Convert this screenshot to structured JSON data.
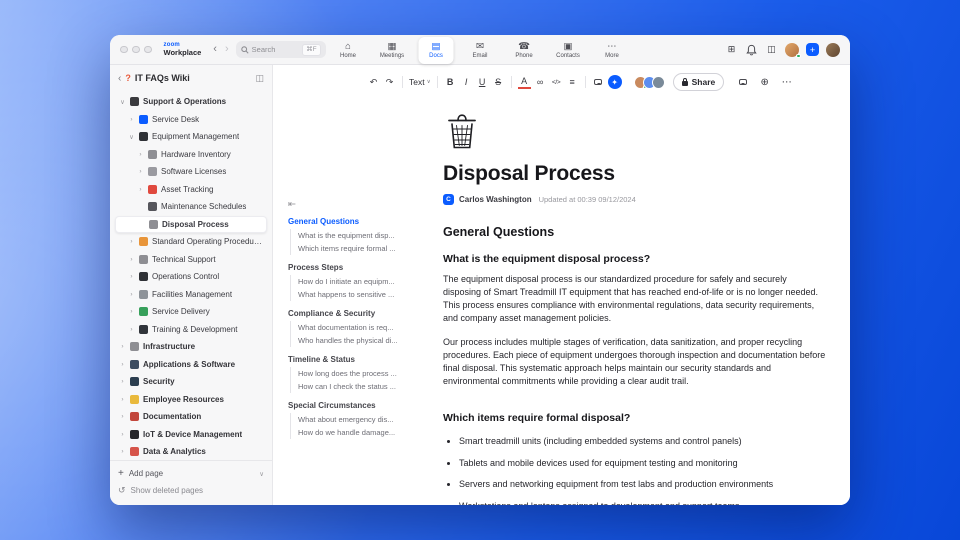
{
  "accent_color": "#0b5cff",
  "titlebar": {
    "logo_primary": "zoom",
    "logo_secondary": "Workplace",
    "back_glyph": "‹",
    "forward_glyph": "›",
    "search": {
      "placeholder": "Search",
      "shortcut": "⌘F"
    },
    "tabs": [
      {
        "name": "tab-home",
        "label": "Home",
        "glyph": "⌂"
      },
      {
        "name": "tab-meetings",
        "label": "Meetings",
        "glyph": "▦"
      },
      {
        "name": "tab-docs",
        "label": "Docs",
        "glyph": "▤",
        "active": true
      },
      {
        "name": "tab-email",
        "label": "Email",
        "glyph": "✉"
      },
      {
        "name": "tab-phone",
        "label": "Phone",
        "glyph": "☎"
      },
      {
        "name": "tab-contacts",
        "label": "Contacts",
        "glyph": "▣"
      },
      {
        "name": "tab-more",
        "label": "More",
        "glyph": "⋯"
      }
    ],
    "right_icons": [
      {
        "name": "apps-grid-icon",
        "glyph": "⊞"
      },
      {
        "name": "notifications-bell-icon",
        "glyph": "bell"
      },
      {
        "name": "side-panel-icon",
        "glyph": "◫"
      }
    ],
    "plus_glyph": "+",
    "plus_color": "#0b5cff"
  },
  "sidebar": {
    "header": {
      "title": "IT FAQs Wiki",
      "icon_glyph": "?",
      "icon_color": "#e8593a",
      "back_glyph": "‹",
      "collapse_glyph": "◫"
    },
    "items": [
      {
        "label": "Support & Operations",
        "depth": 0,
        "icon": "phone-icon",
        "color": "#3a3a3e",
        "chevron": "down"
      },
      {
        "label": "Service Desk",
        "depth": 1,
        "icon": "service-desk-icon",
        "color": "#0b5cff",
        "chevron": "right"
      },
      {
        "label": "Equipment Management",
        "depth": 1,
        "icon": "equipment-icon",
        "color": "#2f3136",
        "chevron": "down"
      },
      {
        "label": "Hardware Inventory",
        "depth": 2,
        "icon": "hardware-icon",
        "color": "#8e8e93",
        "chevron": "right"
      },
      {
        "label": "Software Licenses",
        "depth": 2,
        "icon": "software-icon",
        "color": "#9a9aa0",
        "chevron": "right"
      },
      {
        "label": "Asset Tracking",
        "depth": 2,
        "icon": "asset-pin-icon",
        "color": "#e0493e",
        "chevron": "right"
      },
      {
        "label": "Maintenance Schedules",
        "depth": 2,
        "icon": "maintenance-icon",
        "color": "#55555b",
        "chevron": "none"
      },
      {
        "label": "Disposal Process",
        "depth": 2,
        "icon": "disposal-trash-icon",
        "color": "#8e8e93",
        "chevron": "none",
        "selected": true
      },
      {
        "label": "Standard Operating Procedures",
        "depth": 1,
        "icon": "sop-book-icon",
        "color": "#e8953a",
        "chevron": "right"
      },
      {
        "label": "Technical Support",
        "depth": 1,
        "icon": "technical-support-icon",
        "color": "#8e8e93",
        "chevron": "right"
      },
      {
        "label": "Operations Control",
        "depth": 1,
        "icon": "operations-icon",
        "color": "#2f3136",
        "chevron": "right"
      },
      {
        "label": "Facilities Management",
        "depth": 1,
        "icon": "facilities-icon",
        "color": "#8e9399",
        "chevron": "right"
      },
      {
        "label": "Service Delivery",
        "depth": 1,
        "icon": "delivery-icon",
        "color": "#37a05b",
        "chevron": "right"
      },
      {
        "label": "Training & Development",
        "depth": 1,
        "icon": "training-icon",
        "color": "#30343a",
        "chevron": "right"
      },
      {
        "label": "Infrastructure",
        "depth": 0,
        "icon": "infrastructure-icon",
        "color": "#8e8e93",
        "chevron": "right"
      },
      {
        "label": "Applications & Software",
        "depth": 0,
        "icon": "applications-icon",
        "color": "#3c4c60",
        "chevron": "right"
      },
      {
        "label": "Security",
        "depth": 0,
        "icon": "security-icon",
        "color": "#2c3e50",
        "chevron": "right"
      },
      {
        "label": "Employee Resources",
        "depth": 0,
        "icon": "employee-icon",
        "color": "#e9b93c",
        "chevron": "right"
      },
      {
        "label": "Documentation",
        "depth": 0,
        "icon": "documentation-icon",
        "color": "#c2463c",
        "chevron": "right"
      },
      {
        "label": "IoT & Device Management",
        "depth": 0,
        "icon": "iot-icon",
        "color": "#26262a",
        "chevron": "right"
      },
      {
        "label": "Data & Analytics",
        "depth": 0,
        "icon": "analytics-icon",
        "color": "#d6544a",
        "chevron": "right"
      }
    ],
    "footer": {
      "add_page": "Add page",
      "add_glyph": "+",
      "collapse_glyph": "∨",
      "show_deleted": "Show deleted pages",
      "deleted_glyph": "↺"
    }
  },
  "outline": {
    "collapse_glyph": "⇤",
    "sections": [
      {
        "title": "General Questions",
        "active": true,
        "items": [
          "What is the equipment disp...",
          "Which items require formal ..."
        ]
      },
      {
        "title": "Process Steps",
        "items": [
          "How do I initiate an equipm...",
          "What happens to sensitive ..."
        ]
      },
      {
        "title": "Compliance & Security",
        "items": [
          "What documentation is req...",
          "Who handles the physical di..."
        ]
      },
      {
        "title": "Timeline & Status",
        "items": [
          "How long does the process ...",
          "How can I check the status ..."
        ]
      },
      {
        "title": "Special Circumstances",
        "items": [
          "What about emergency dis...",
          "How do we handle damage..."
        ]
      }
    ]
  },
  "toolbar": {
    "items": [
      {
        "name": "undo-button",
        "glyph": "↶"
      },
      {
        "name": "redo-button",
        "glyph": "↷"
      },
      {
        "divider": true
      },
      {
        "name": "text-style-dropdown",
        "label": "Text",
        "glyph": "∨",
        "dropdown": true
      },
      {
        "divider": true
      },
      {
        "name": "bold-button",
        "glyph": "B",
        "cls": "fb"
      },
      {
        "name": "italic-button",
        "glyph": "I",
        "cls": "fi"
      },
      {
        "name": "underline-button",
        "glyph": "U",
        "cls": "fu"
      },
      {
        "name": "strikethrough-button",
        "glyph": "S",
        "cls": "fs"
      },
      {
        "divider": true
      },
      {
        "name": "text-color-button",
        "glyph": "A",
        "cls": "fa"
      },
      {
        "name": "link-button",
        "glyph": "∞"
      },
      {
        "name": "code-button",
        "glyph": "</>",
        "cls": "fc"
      },
      {
        "name": "list-button",
        "glyph": "≡"
      },
      {
        "divider": true
      },
      {
        "name": "comment-button",
        "glyph": "bubble"
      },
      {
        "name": "ai-companion-button",
        "glyph": "✦",
        "cls": "ai"
      }
    ],
    "avatars": [
      "#c98a5e",
      "#5b8def",
      "#7a8a99"
    ],
    "share_label": "Share",
    "right_items": [
      {
        "name": "comments-panel-icon",
        "glyph": "bubble"
      },
      {
        "name": "language-globe-icon",
        "glyph": "⊕"
      },
      {
        "name": "more-options-icon",
        "glyph": "⋯"
      }
    ]
  },
  "doc": {
    "title": "Disposal Process",
    "author": "Carlos Washington",
    "updated": "Updated at 00:39 09/12/2024",
    "section_heading": "General Questions",
    "question1": "What is the equipment disposal process?",
    "paragraph1": "The equipment disposal process is our standardized procedure for safely and securely disposing of Smart Treadmill IT equipment that has reached end-of-life or is no longer needed. This process ensures compliance with environmental regulations, data security requirements, and company asset management policies.",
    "paragraph2": "Our process includes multiple stages of verification, data sanitization, and proper recycling procedures. Each piece of equipment undergoes thorough inspection and documentation before final disposal. This systematic approach helps maintain our security standards and environmental commitments while providing a clear audit trail.",
    "question2": "Which items require formal disposal?",
    "bullets": [
      "Smart treadmill units (including embedded systems and control panels)",
      "Tablets and mobile devices used for equipment testing and monitoring",
      "Servers and networking equipment from test labs and production environments",
      "Workstations and laptops assigned to development and support teams"
    ]
  }
}
